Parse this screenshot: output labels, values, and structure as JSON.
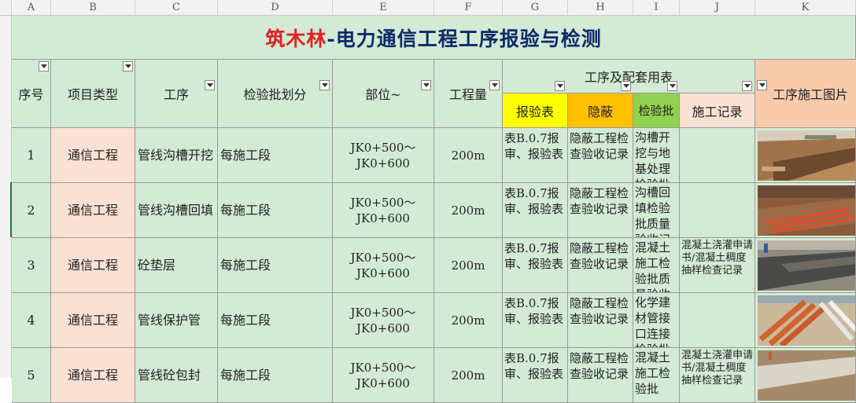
{
  "columns": [
    "A",
    "B",
    "C",
    "D",
    "E",
    "F",
    "G",
    "H",
    "I",
    "J",
    "K"
  ],
  "title": {
    "brand": "筑木林",
    "rest": "-电力通信工程工序报验与检测"
  },
  "headers": {
    "seq": "序号",
    "project_type": "项目类型",
    "process": "工序",
    "batch": "检验批划分",
    "location": "部位~",
    "quantity": "工程量",
    "group": "工序及配套用表",
    "report": "报验表",
    "hidden": "隐蔽",
    "inspect": "检验批",
    "record": "施工记录",
    "photo": "工序施工图片"
  },
  "colors": {
    "brand_red": "#e02020",
    "title_blue": "#0d2a6b",
    "green": "#d3ead5",
    "pink": "#fbe0d4",
    "yellow": "#ffff00",
    "orange": "#ffc000",
    "inspect_green": "#92d050",
    "photo_hdr": "#f8cbad"
  },
  "rows": [
    {
      "seq": "1",
      "type": "通信工程",
      "process": "管线沟槽开挖",
      "batch": "每施工段",
      "loc1": "JK0+500～",
      "loc2": "JK0+600",
      "qty": "200m",
      "report": "表B.0.7报审、报验表",
      "hidden": "隐蔽工程检查验收记录",
      "inspect": "沟槽开挖与地基处理检验批",
      "record": ""
    },
    {
      "seq": "2",
      "type": "通信工程",
      "process": "管线沟槽回填",
      "batch": "每施工段",
      "loc1": "JK0+500～",
      "loc2": "JK0+600",
      "qty": "200m",
      "report": "表B.0.7报审、报验表",
      "hidden": "隐蔽工程检查验收记录",
      "inspect": "沟槽回填检验批质量验收记",
      "record": ""
    },
    {
      "seq": "3",
      "type": "通信工程",
      "process": "砼垫层",
      "batch": "每施工段",
      "loc1": "JK0+500～",
      "loc2": "JK0+600",
      "qty": "200m",
      "report": "表B.0.7报审、报验表",
      "hidden": "隐蔽工程检查验收记录",
      "inspect": "混凝土施工检验批质量验收",
      "record": "混凝土浇灌申请书/混凝土稠度抽样检查记录"
    },
    {
      "seq": "4",
      "type": "通信工程",
      "process": "管线保护管",
      "batch": "每施工段",
      "loc1": "JK0+500～",
      "loc2": "JK0+600",
      "qty": "200m",
      "report": "表B.0.7报审、报验表",
      "hidden": "隐蔽工程检查验收记录",
      "inspect": "化学建材管接口连接检验批",
      "record": ""
    },
    {
      "seq": "5",
      "type": "通信工程",
      "process": "管线砼包封",
      "batch": "每施工段",
      "loc1": "JK0+500～",
      "loc2": "JK0+600",
      "qty": "200m",
      "report": "表B.0.7报审、报验表",
      "hidden": "隐蔽工程检查验收记录",
      "inspect": "混凝土施工检验批",
      "record": "混凝土浇灌申请书/混凝土稠度抽样检查记录"
    }
  ]
}
